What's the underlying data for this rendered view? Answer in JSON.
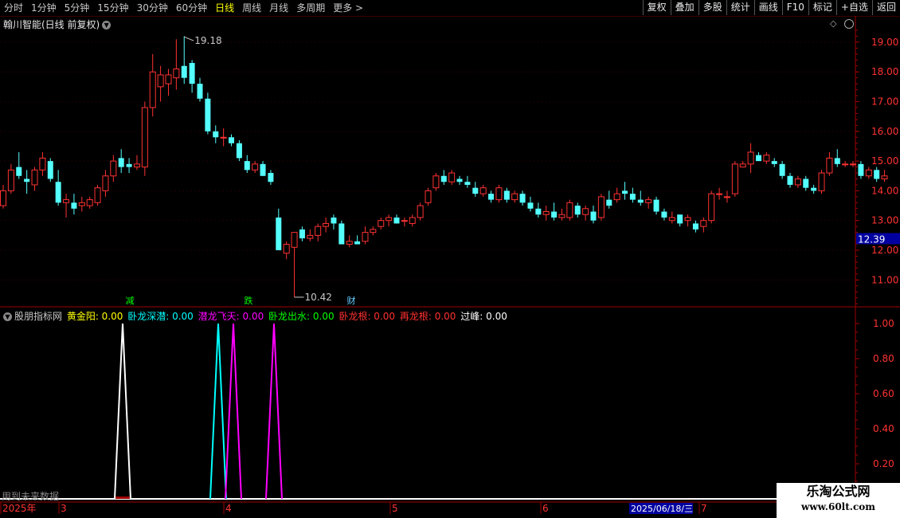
{
  "toolbar": {
    "periods": [
      {
        "label": "分时",
        "active": false
      },
      {
        "label": "1分钟",
        "active": false
      },
      {
        "label": "5分钟",
        "active": false
      },
      {
        "label": "15分钟",
        "active": false
      },
      {
        "label": "30分钟",
        "active": false
      },
      {
        "label": "60分钟",
        "active": false
      },
      {
        "label": "日线",
        "active": true
      },
      {
        "label": "周线",
        "active": false
      },
      {
        "label": "月线",
        "active": false
      },
      {
        "label": "多周期",
        "active": false
      },
      {
        "label": "更多 >",
        "active": false
      }
    ],
    "buttons": [
      "复权",
      "叠加",
      "多股",
      "统计",
      "画线",
      "F10",
      "标记",
      "+自选",
      "返回"
    ]
  },
  "chart_title": "翰川智能(日线 前复权)",
  "price_axis": [
    "19.00",
    "18.00",
    "17.00",
    "16.00",
    "15.00",
    "14.00",
    "13.00",
    "12.00",
    "11.00"
  ],
  "current_price": "12.39",
  "high_label": "19.18",
  "low_label": "10.42",
  "signals": [
    {
      "text": "减",
      "color": "#00ff00"
    },
    {
      "text": "跌",
      "color": "#00ff00"
    },
    {
      "text": "财",
      "color": "#66ccff"
    }
  ],
  "indicator": {
    "name": "股朋指标网",
    "items": [
      {
        "label": "黄金阳:",
        "value": "0.00",
        "color": "#ffff00"
      },
      {
        "label": "卧龙深潜:",
        "value": "0.00",
        "color": "#00ffff"
      },
      {
        "label": "潜龙飞天:",
        "value": "0.00",
        "color": "#ff00ff"
      },
      {
        "label": "卧龙出水:",
        "value": "0.00",
        "color": "#00ff00"
      },
      {
        "label": "卧龙根:",
        "value": "0.00",
        "color": "#ff3030"
      },
      {
        "label": "再龙根:",
        "value": "0.00",
        "color": "#ff3030"
      },
      {
        "label": "过峰:",
        "value": "0.00",
        "color": "#ffffff"
      }
    ],
    "axis": [
      "1.00",
      "0.80",
      "0.60",
      "0.40",
      "0.20"
    ],
    "peaks": [
      {
        "color": "#ffffff",
        "value": 1.0
      },
      {
        "color": "#00ffff",
        "value": 1.0
      },
      {
        "color": "#ff00ff",
        "value": 1.0
      },
      {
        "color": "#ff00ff",
        "value": 1.0
      }
    ]
  },
  "date_axis": [
    "2025年",
    "3",
    "4",
    "5",
    "6",
    "7"
  ],
  "cursor_date": "2025/06/18/三",
  "future_text": "用到未来数据",
  "watermark": {
    "line1": "乐淘公式网",
    "line2": "www.60lt.com"
  },
  "chart_data": {
    "type": "candlestick",
    "ylim": [
      10.0,
      19.6
    ],
    "ohlc": [
      [
        13.5,
        14.2,
        13.4,
        14.0
      ],
      [
        14.0,
        14.9,
        13.9,
        14.7
      ],
      [
        14.8,
        15.3,
        14.4,
        14.5
      ],
      [
        14.4,
        14.7,
        13.9,
        14.3
      ],
      [
        14.2,
        14.8,
        14.0,
        14.7
      ],
      [
        14.7,
        15.3,
        14.5,
        15.1
      ],
      [
        15.0,
        15.1,
        14.3,
        14.4
      ],
      [
        14.3,
        14.7,
        13.5,
        13.6
      ],
      [
        13.6,
        13.9,
        13.1,
        13.7
      ],
      [
        13.6,
        13.9,
        13.2,
        13.4
      ],
      [
        13.5,
        13.8,
        13.3,
        13.6
      ],
      [
        13.5,
        13.8,
        13.4,
        13.7
      ],
      [
        13.6,
        14.2,
        13.5,
        14.1
      ],
      [
        14.0,
        14.7,
        13.8,
        14.5
      ],
      [
        14.5,
        15.2,
        14.3,
        15.0
      ],
      [
        15.1,
        15.4,
        14.6,
        14.8
      ],
      [
        14.9,
        15.1,
        14.6,
        14.8
      ],
      [
        14.8,
        15.2,
        14.7,
        14.9
      ],
      [
        14.8,
        17.0,
        14.5,
        16.8
      ],
      [
        16.8,
        18.6,
        16.5,
        18.0
      ],
      [
        17.5,
        18.2,
        17.0,
        17.9
      ],
      [
        17.6,
        18.1,
        17.2,
        17.9
      ],
      [
        17.8,
        19.1,
        17.4,
        18.1
      ],
      [
        18.2,
        19.2,
        17.6,
        17.8
      ],
      [
        18.3,
        18.4,
        17.3,
        17.6
      ],
      [
        17.6,
        17.8,
        17.0,
        17.1
      ],
      [
        17.1,
        17.3,
        15.9,
        16.0
      ],
      [
        16.0,
        16.2,
        15.6,
        15.8
      ],
      [
        15.8,
        16.1,
        15.5,
        15.8
      ],
      [
        15.8,
        15.9,
        15.5,
        15.6
      ],
      [
        15.6,
        15.7,
        15.0,
        15.1
      ],
      [
        15.0,
        15.2,
        14.6,
        14.7
      ],
      [
        14.7,
        15.0,
        14.6,
        14.9
      ],
      [
        14.9,
        15.0,
        14.5,
        14.5
      ],
      [
        14.6,
        14.7,
        14.2,
        14.3
      ],
      [
        13.1,
        13.4,
        12.0,
        12.0
      ],
      [
        11.9,
        12.3,
        11.7,
        12.2
      ],
      [
        12.1,
        12.5,
        10.42,
        12.6
      ],
      [
        12.7,
        12.8,
        12.3,
        12.4
      ],
      [
        12.4,
        12.7,
        12.3,
        12.5
      ],
      [
        12.5,
        12.9,
        12.3,
        12.8
      ],
      [
        12.8,
        13.1,
        12.6,
        12.9
      ],
      [
        13.1,
        13.2,
        12.7,
        12.9
      ],
      [
        12.9,
        13.0,
        12.2,
        12.2
      ],
      [
        12.2,
        12.5,
        12.1,
        12.3
      ],
      [
        12.3,
        12.5,
        12.2,
        12.2
      ],
      [
        12.3,
        12.8,
        12.2,
        12.6
      ],
      [
        12.6,
        12.8,
        12.5,
        12.7
      ],
      [
        12.8,
        13.1,
        12.7,
        13.0
      ],
      [
        13.0,
        13.2,
        12.8,
        13.1
      ],
      [
        13.1,
        13.2,
        12.9,
        12.9
      ],
      [
        13.0,
        13.1,
        12.8,
        13.0
      ],
      [
        12.9,
        13.2,
        12.8,
        13.1
      ],
      [
        13.1,
        13.6,
        13.0,
        13.5
      ],
      [
        13.6,
        14.1,
        13.5,
        14.0
      ],
      [
        14.1,
        14.6,
        14.0,
        14.5
      ],
      [
        14.5,
        14.7,
        14.2,
        14.3
      ],
      [
        14.3,
        14.7,
        14.2,
        14.6
      ],
      [
        14.4,
        14.5,
        14.2,
        14.3
      ],
      [
        14.3,
        14.5,
        14.1,
        14.2
      ],
      [
        14.1,
        14.3,
        13.8,
        13.9
      ],
      [
        13.9,
        14.2,
        13.8,
        14.1
      ],
      [
        13.9,
        14.0,
        13.6,
        13.7
      ],
      [
        13.7,
        14.2,
        13.6,
        14.1
      ],
      [
        14.0,
        14.1,
        13.6,
        13.7
      ],
      [
        13.7,
        14.0,
        13.6,
        13.9
      ],
      [
        13.9,
        14.0,
        13.5,
        13.6
      ],
      [
        13.6,
        13.8,
        13.3,
        13.4
      ],
      [
        13.4,
        13.6,
        13.1,
        13.2
      ],
      [
        13.2,
        13.5,
        13.0,
        13.3
      ],
      [
        13.3,
        13.6,
        13.0,
        13.1
      ],
      [
        13.1,
        13.4,
        13.0,
        13.2
      ],
      [
        13.1,
        13.7,
        13.0,
        13.6
      ],
      [
        13.5,
        13.6,
        13.1,
        13.2
      ],
      [
        13.2,
        13.5,
        13.0,
        13.4
      ],
      [
        13.3,
        13.5,
        12.9,
        13.0
      ],
      [
        13.1,
        13.9,
        13.0,
        13.8
      ],
      [
        13.7,
        14.0,
        13.4,
        13.5
      ],
      [
        13.7,
        14.1,
        13.6,
        13.9
      ],
      [
        14.0,
        14.3,
        13.7,
        13.9
      ],
      [
        13.9,
        14.1,
        13.6,
        13.7
      ],
      [
        13.7,
        14.0,
        13.5,
        13.6
      ],
      [
        13.6,
        13.8,
        13.4,
        13.7
      ],
      [
        13.7,
        13.8,
        13.2,
        13.3
      ],
      [
        13.3,
        13.4,
        13.0,
        13.1
      ],
      [
        13.0,
        13.3,
        12.9,
        13.1
      ],
      [
        13.2,
        13.2,
        12.8,
        12.9
      ],
      [
        13.0,
        13.2,
        12.8,
        13.1
      ],
      [
        12.9,
        13.0,
        12.6,
        12.7
      ],
      [
        12.8,
        13.1,
        12.6,
        13.0
      ],
      [
        13.0,
        14.0,
        12.9,
        13.9
      ],
      [
        13.9,
        14.1,
        13.7,
        13.9
      ],
      [
        13.8,
        14.0,
        13.6,
        13.8
      ],
      [
        13.9,
        15.0,
        13.8,
        14.9
      ],
      [
        14.8,
        15.0,
        14.8,
        14.9
      ],
      [
        14.9,
        15.6,
        14.6,
        15.3
      ],
      [
        15.2,
        15.3,
        15.0,
        15.0
      ],
      [
        15.0,
        15.3,
        14.9,
        15.2
      ],
      [
        15.0,
        15.1,
        14.8,
        14.9
      ],
      [
        14.9,
        15.0,
        14.4,
        14.5
      ],
      [
        14.5,
        14.6,
        14.1,
        14.2
      ],
      [
        14.2,
        14.5,
        14.1,
        14.4
      ],
      [
        14.4,
        14.5,
        14.0,
        14.1
      ],
      [
        14.1,
        14.2,
        13.9,
        14.0
      ],
      [
        14.0,
        14.7,
        13.9,
        14.6
      ],
      [
        14.6,
        15.3,
        14.5,
        15.1
      ],
      [
        15.1,
        15.4,
        14.8,
        14.9
      ],
      [
        14.9,
        15.0,
        14.8,
        14.9
      ],
      [
        14.9,
        15.0,
        14.8,
        14.9
      ],
      [
        14.9,
        15.0,
        14.4,
        14.5
      ],
      [
        14.5,
        14.8,
        14.4,
        14.7
      ],
      [
        14.7,
        14.8,
        14.3,
        14.4
      ],
      [
        14.4,
        14.7,
        14.3,
        14.5
      ]
    ]
  }
}
